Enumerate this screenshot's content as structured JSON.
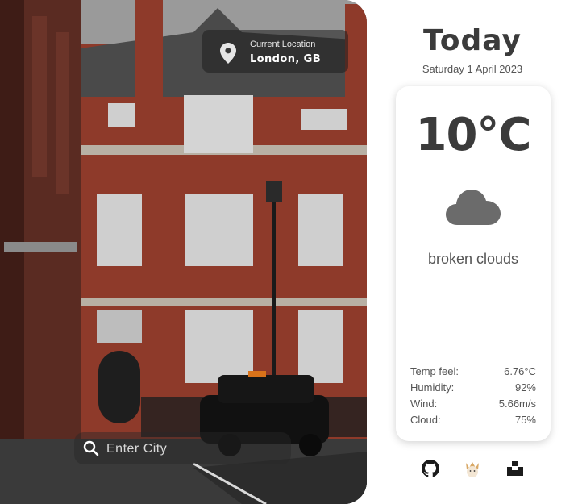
{
  "location": {
    "caption": "Current Location",
    "city": "London, GB"
  },
  "search": {
    "placeholder": "Enter City"
  },
  "header": {
    "title": "Today",
    "date": "Saturday 1 April 2023"
  },
  "weather": {
    "temperature": "10°C",
    "condition": "broken clouds",
    "icon": "cloud-icon"
  },
  "stats": [
    {
      "label": "Temp feel:",
      "value": "6.76°C"
    },
    {
      "label": "Humidity:",
      "value": "92%"
    },
    {
      "label": "Wind:",
      "value": "5.66m/s"
    },
    {
      "label": "Cloud:",
      "value": "75%"
    }
  ],
  "footer": {
    "icons": [
      "github-icon",
      "avatar-icon",
      "unsplash-icon"
    ]
  },
  "colors": {
    "text_dark": "#3b3b3b",
    "text_muted": "#555555",
    "cloud_gray": "#6b6b6b",
    "brick": "#8e3a2a"
  }
}
